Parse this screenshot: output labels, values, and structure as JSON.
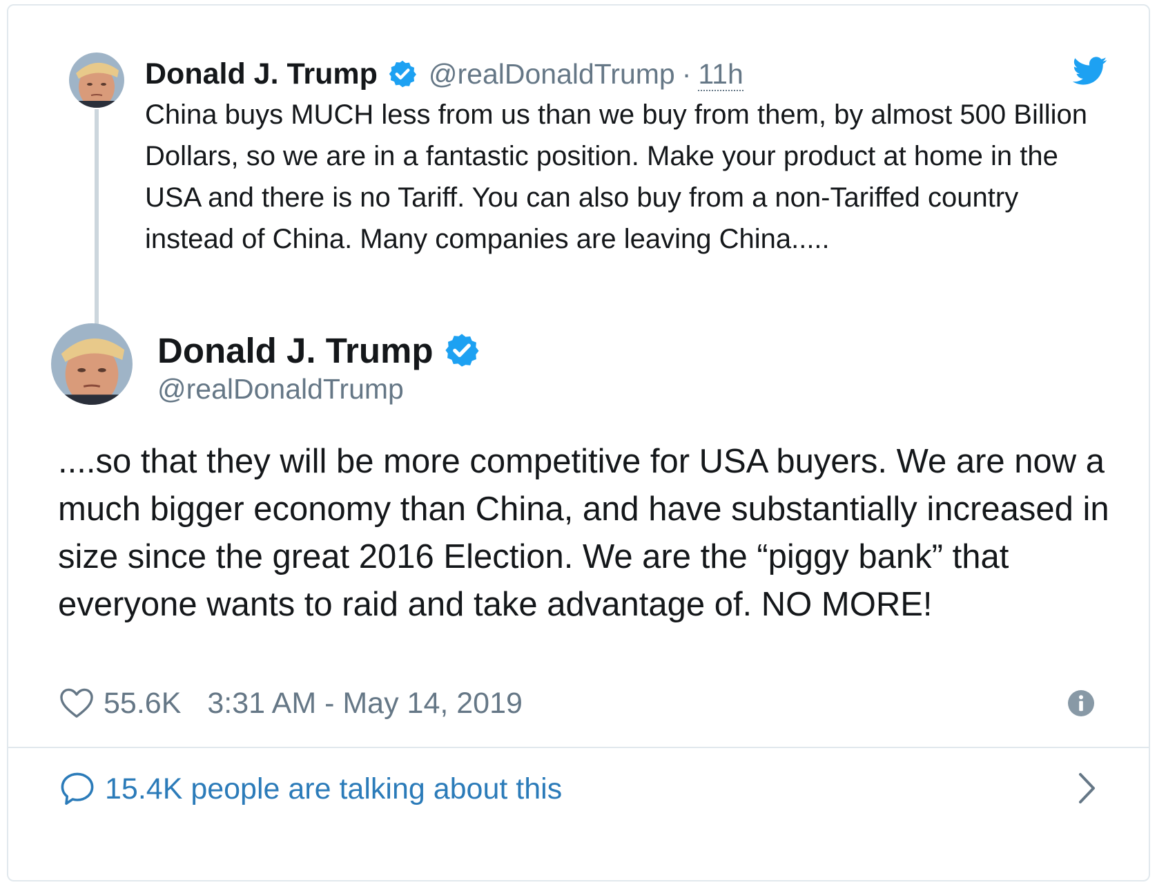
{
  "parent_tweet": {
    "author_name": "Donald J. Trump",
    "handle": "@realDonaldTrump",
    "separator": "·",
    "relative_time": "11h",
    "text": "China buys MUCH less from us than we buy from them, by almost 500 Billion Dollars, so we are in a fantastic position. Make your product at home in the USA and there is no Tariff. You can also buy from a non-Tariffed country instead of China. Many companies are leaving China....."
  },
  "main_tweet": {
    "author_name": "Donald J. Trump",
    "handle": "@realDonaldTrump",
    "text": "....so that they will be more competitive for USA buyers. We are now a much bigger economy than China, and have substantially increased in size since the great 2016 Election. We are the “piggy bank” that everyone wants to raid and take advantage of. NO MORE!",
    "like_count": "55.6K",
    "timestamp": "3:31 AM - May 14, 2019"
  },
  "footer": {
    "talking_label": "15.4K people are talking about this"
  },
  "colors": {
    "brand_blue": "#1da1f2",
    "verified_blue": "#1da1f2",
    "link_blue": "#2b7bb9",
    "secondary_text": "#657786",
    "primary_text": "#14171a",
    "border": "#e1e8ed"
  },
  "icons": {
    "brand": "twitter-bird-icon",
    "verified": "verified-badge-icon",
    "like": "heart-icon",
    "info": "info-icon",
    "reply": "speech-bubble-icon",
    "expand": "chevron-right-icon"
  }
}
